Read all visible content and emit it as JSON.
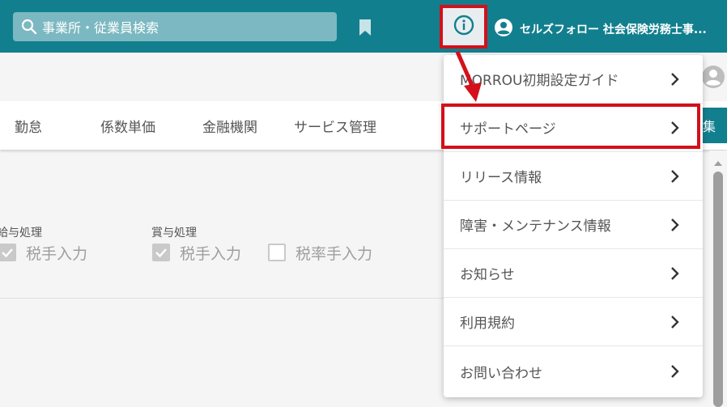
{
  "header": {
    "search_placeholder": "事業所・従業員検索",
    "user_name": "セルズフォロー 社会保険労務士事..."
  },
  "nav": {
    "tabs": [
      "勤怠",
      "係数単価",
      "金融機関",
      "サービス管理"
    ],
    "edge_button_label": "集"
  },
  "settings": {
    "salary_group_label": "給与処理",
    "bonus_group_label": "賞与処理",
    "salary_tax_manual": {
      "label": "税手入力",
      "checked": true
    },
    "bonus_tax_manual": {
      "label": "税手入力",
      "checked": true
    },
    "bonus_rate_manual": {
      "label": "税率手入力",
      "checked": false
    }
  },
  "help_menu": {
    "items": [
      {
        "label": "MORROU初期設定ガイド"
      },
      {
        "label": "サポートページ",
        "highlighted": true
      },
      {
        "label": "リリース情報"
      },
      {
        "label": "障害・メンテナンス情報"
      },
      {
        "label": "お知らせ"
      },
      {
        "label": "利用規約"
      },
      {
        "label": "お問い合わせ"
      }
    ]
  },
  "colors": {
    "header_bg": "#127f8e",
    "highlight_red": "#d4101a"
  }
}
